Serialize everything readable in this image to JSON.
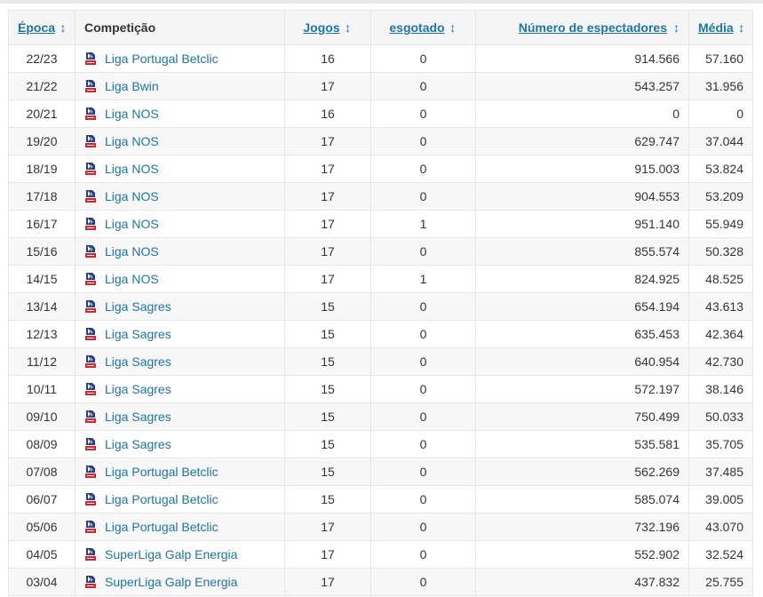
{
  "table": {
    "headers": {
      "season": "Época",
      "competition": "Competição",
      "games": "Jogos",
      "sold_out": "esgotado",
      "spectators": "Número de espectadores",
      "average": "Média"
    },
    "sort_icon": "↕",
    "colors": {
      "link": "#1d75a3",
      "text": "#333333",
      "header_bg": "#f5f5f5",
      "stripe_bg": "#f7f7f7",
      "border": "#e6e6e6"
    },
    "rows": [
      {
        "season": "22/23",
        "competition": "Liga Portugal Betclic",
        "games": "16",
        "sold_out": "0",
        "spectators": "914.566",
        "average": "57.160"
      },
      {
        "season": "21/22",
        "competition": "Liga Bwin",
        "games": "17",
        "sold_out": "0",
        "spectators": "543.257",
        "average": "31.956"
      },
      {
        "season": "20/21",
        "competition": "Liga NOS",
        "games": "16",
        "sold_out": "0",
        "spectators": "0",
        "average": "0"
      },
      {
        "season": "19/20",
        "competition": "Liga NOS",
        "games": "17",
        "sold_out": "0",
        "spectators": "629.747",
        "average": "37.044"
      },
      {
        "season": "18/19",
        "competition": "Liga NOS",
        "games": "17",
        "sold_out": "0",
        "spectators": "915.003",
        "average": "53.824"
      },
      {
        "season": "17/18",
        "competition": "Liga NOS",
        "games": "17",
        "sold_out": "0",
        "spectators": "904.553",
        "average": "53.209"
      },
      {
        "season": "16/17",
        "competition": "Liga NOS",
        "games": "17",
        "sold_out": "1",
        "spectators": "951.140",
        "average": "55.949"
      },
      {
        "season": "15/16",
        "competition": "Liga NOS",
        "games": "17",
        "sold_out": "0",
        "spectators": "855.574",
        "average": "50.328"
      },
      {
        "season": "14/15",
        "competition": "Liga NOS",
        "games": "17",
        "sold_out": "1",
        "spectators": "824.925",
        "average": "48.525"
      },
      {
        "season": "13/14",
        "competition": "Liga Sagres",
        "games": "15",
        "sold_out": "0",
        "spectators": "654.194",
        "average": "43.613"
      },
      {
        "season": "12/13",
        "competition": "Liga Sagres",
        "games": "15",
        "sold_out": "0",
        "spectators": "635.453",
        "average": "42.364"
      },
      {
        "season": "11/12",
        "competition": "Liga Sagres",
        "games": "15",
        "sold_out": "0",
        "spectators": "640.954",
        "average": "42.730"
      },
      {
        "season": "10/11",
        "competition": "Liga Sagres",
        "games": "15",
        "sold_out": "0",
        "spectators": "572.197",
        "average": "38.146"
      },
      {
        "season": "09/10",
        "competition": "Liga Sagres",
        "games": "15",
        "sold_out": "0",
        "spectators": "750.499",
        "average": "50.033"
      },
      {
        "season": "08/09",
        "competition": "Liga Sagres",
        "games": "15",
        "sold_out": "0",
        "spectators": "535.581",
        "average": "35.705"
      },
      {
        "season": "07/08",
        "competition": "Liga Portugal Betclic",
        "games": "15",
        "sold_out": "0",
        "spectators": "562.269",
        "average": "37.485"
      },
      {
        "season": "06/07",
        "competition": "Liga Portugal Betclic",
        "games": "15",
        "sold_out": "0",
        "spectators": "585.074",
        "average": "39.005"
      },
      {
        "season": "05/06",
        "competition": "Liga Portugal Betclic",
        "games": "17",
        "sold_out": "0",
        "spectators": "732.196",
        "average": "43.070"
      },
      {
        "season": "04/05",
        "competition": "SuperLiga Galp Energia",
        "games": "17",
        "sold_out": "0",
        "spectators": "552.902",
        "average": "32.524"
      },
      {
        "season": "03/04",
        "competition": "SuperLiga Galp Energia",
        "games": "17",
        "sold_out": "0",
        "spectators": "437.832",
        "average": "25.755"
      }
    ]
  }
}
